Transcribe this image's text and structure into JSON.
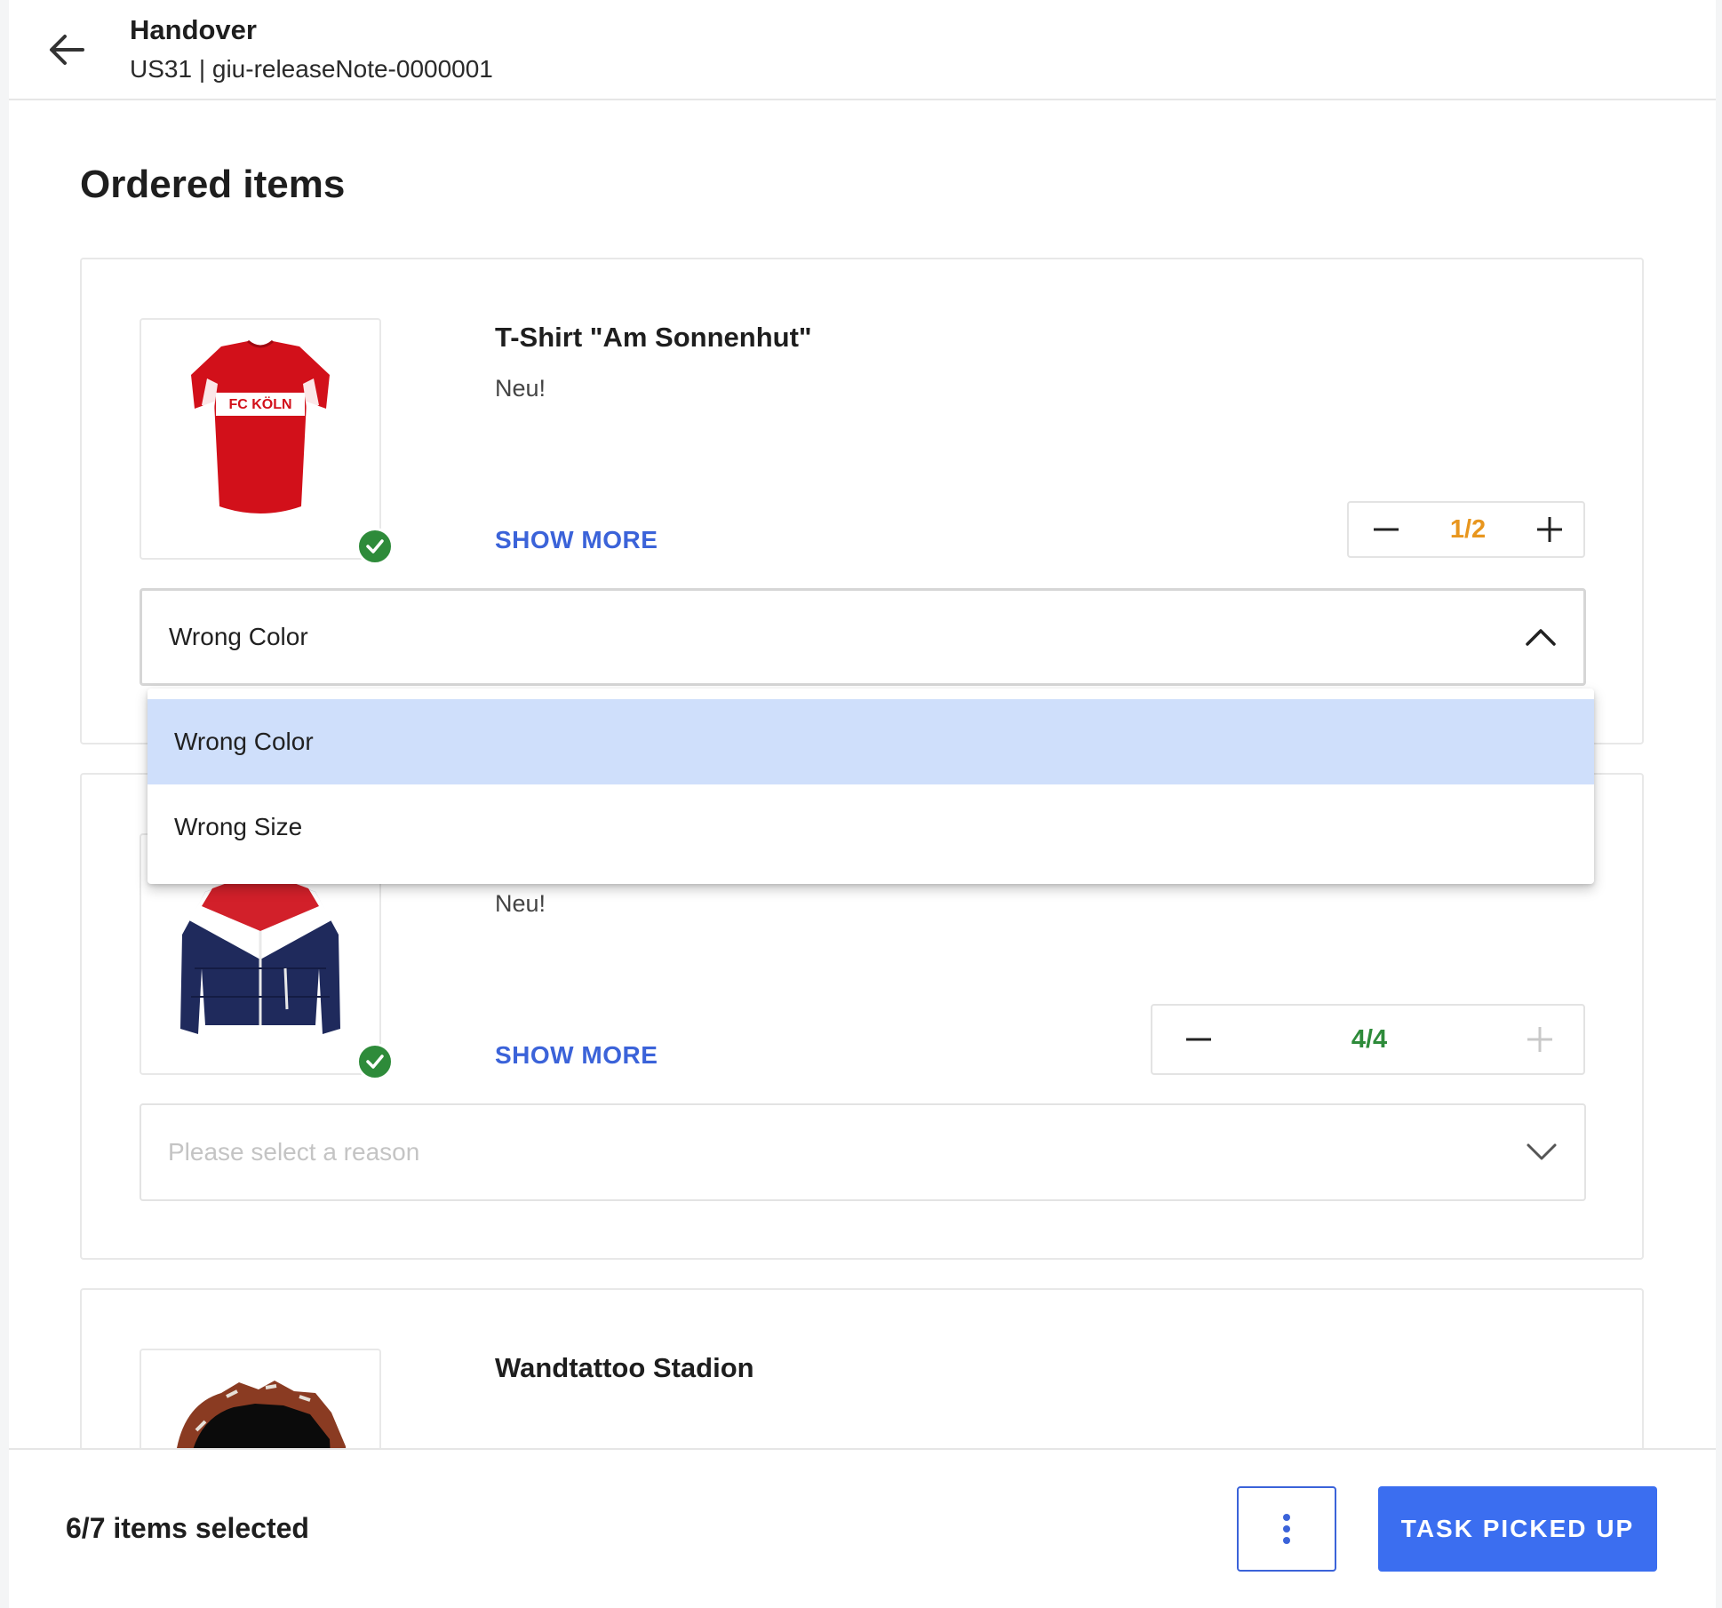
{
  "header": {
    "title": "Handover",
    "subtitle": "US31 | giu-releaseNote-0000001",
    "back_icon": "arrow-left-icon"
  },
  "page": {
    "heading": "Ordered items"
  },
  "items": [
    {
      "name": "T-Shirt \"Am Sonnenhut\"",
      "tag": "Neu!",
      "show_more": "SHOW MORE",
      "quantity": "1/2",
      "quantity_color": "#e8961e",
      "reason": "Wrong Color",
      "reason_open": true,
      "image": "red-tshirt-image",
      "image_text": "FC KÖLN"
    },
    {
      "name": "",
      "tag": "Neu!",
      "show_more": "SHOW MORE",
      "quantity": "4/4",
      "quantity_color": "#2e8b3a",
      "reason_placeholder": "Please select a reason",
      "image": "navy-jacket-image"
    },
    {
      "name": "Wandtattoo Stadion",
      "image": "wall-tattoo-image"
    }
  ],
  "dropdown": {
    "options": [
      "Wrong Color",
      "Wrong Size"
    ],
    "selected": "Wrong Color"
  },
  "footer": {
    "selection_count": "6/7 items selected",
    "more_icon": "more-vertical-icon",
    "primary_label": "TASK PICKED UP"
  },
  "colors": {
    "accent": "#3b6ef0",
    "link": "#3b63d9",
    "success": "#2e8b3a",
    "warning": "#e8961e",
    "menu_selected": "#cfdffb"
  }
}
